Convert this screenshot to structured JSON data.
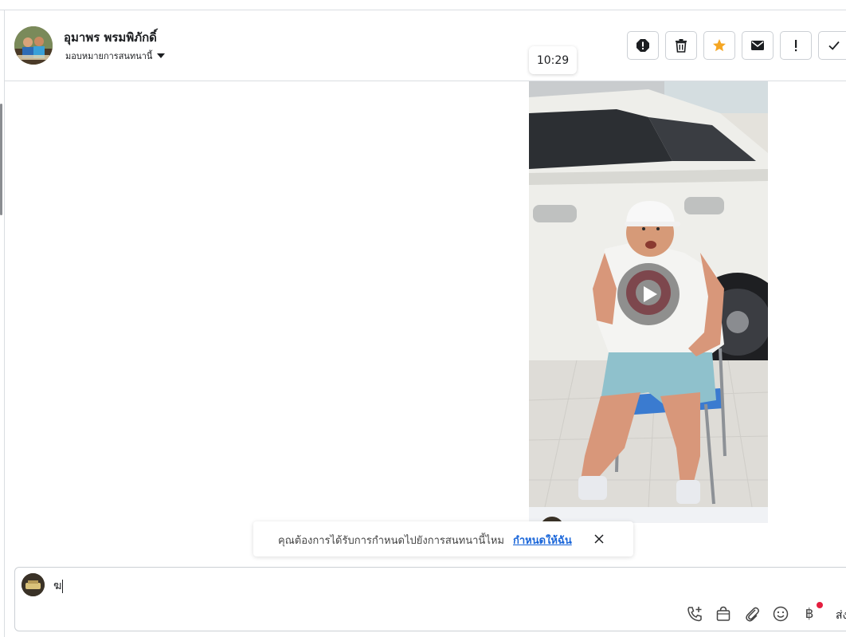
{
  "conversation": {
    "contact_name": "อุมาพร พรมพิภักดิ์",
    "assign_label": "มอบหมายการสนทนานี้",
    "avatar_icon": "contact-avatar"
  },
  "actions": [
    {
      "icon": "spam-icon",
      "name": "mark-spam-button"
    },
    {
      "icon": "trash-icon",
      "name": "delete-button"
    },
    {
      "icon": "star-icon",
      "name": "star-button",
      "color": "#f5a623"
    },
    {
      "icon": "envelope-icon",
      "name": "mark-unread-button"
    },
    {
      "icon": "exclamation-icon",
      "name": "follow-up-button"
    },
    {
      "icon": "check-icon",
      "name": "mark-done-button"
    }
  ],
  "message": {
    "time": "10:29",
    "media_type": "video"
  },
  "banner": {
    "text": "คุณต้องการได้รับการกำหนดไปยังการสนทนานี้ไหม",
    "link": "กำหนดให้ฉัน"
  },
  "composer": {
    "value": "ฆ",
    "send_label": "ส่ง",
    "tools": [
      "call-icon",
      "shopping-bag-icon",
      "paperclip-icon",
      "emoji-icon",
      "baht-icon"
    ],
    "baht_symbol": "฿"
  },
  "colors": {
    "link": "#1a66d9",
    "star": "#f5a623",
    "notification_dot": "#e41e3f"
  }
}
